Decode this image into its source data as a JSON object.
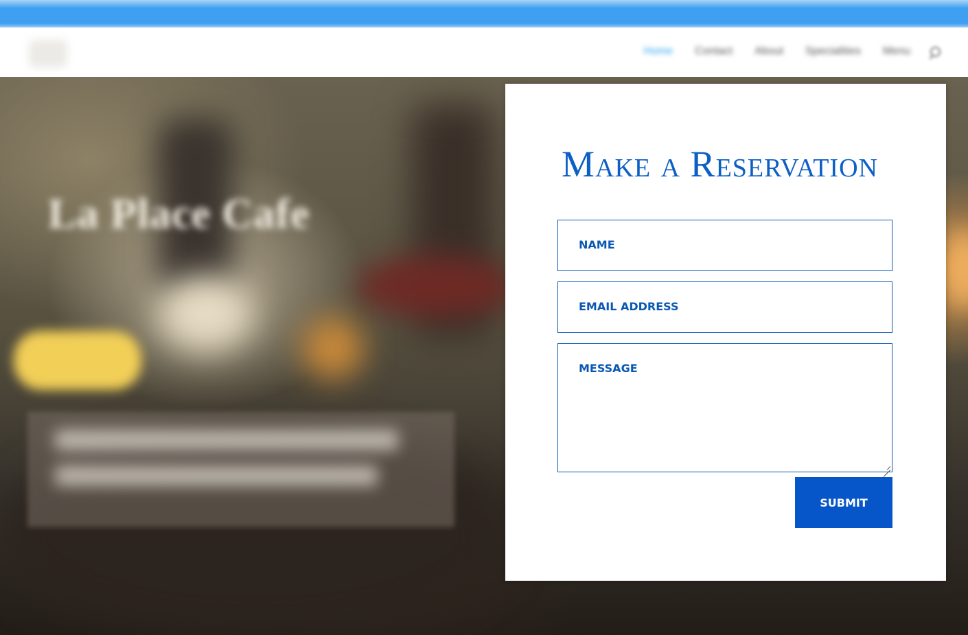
{
  "header": {
    "nav": [
      "Home",
      "Contact",
      "About",
      "Specialities",
      "Menu"
    ],
    "active_index": 0,
    "search_icon": "search-icon"
  },
  "hero": {
    "title": "La Place Cafe"
  },
  "reservation": {
    "title": "Make a Reservation",
    "name_placeholder": "NAME",
    "email_placeholder": "EMAIL ADDRESS",
    "message_placeholder": "MESSAGE",
    "submit_label": "SUBMIT"
  },
  "colors": {
    "accent": "#0c5fc4",
    "submit_bg": "#0756c9",
    "nav_active": "#2ea3f2",
    "topbar": "#3f9ff0"
  }
}
